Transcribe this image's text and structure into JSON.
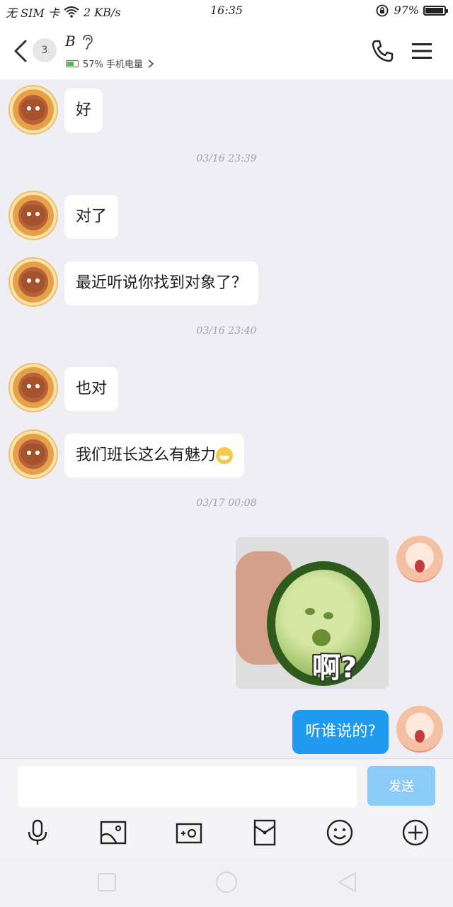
{
  "status_bar": {
    "sim": "无 SIM 卡",
    "speed": "2 KB/s",
    "time": "16:35",
    "battery_percent": "97%",
    "battery_level": 0.97
  },
  "header": {
    "unread_count": "3",
    "contact_name": "B",
    "sub_status": "57% 手机电量",
    "peer_battery_level": 0.57
  },
  "messages": [
    {
      "side": "left",
      "text": "好"
    },
    {
      "type": "timestamp",
      "text": "03/16 23:39"
    },
    {
      "side": "left",
      "text": "对了"
    },
    {
      "side": "left",
      "text": "最近听说你找到对象了？"
    },
    {
      "type": "timestamp",
      "text": "03/16 23:40"
    },
    {
      "side": "left",
      "text": "也对"
    },
    {
      "side": "left",
      "text": "我们班长这么有魅力"
    },
    {
      "type": "timestamp",
      "text": "03/17 00:08"
    },
    {
      "side": "right",
      "type": "sticker",
      "caption": "啊?"
    },
    {
      "side": "right",
      "text": "听谁说的?"
    }
  ],
  "input": {
    "placeholder": "",
    "send_label": "发送"
  },
  "toolbar": {
    "icons": [
      "microphone-icon",
      "image-icon",
      "camera-icon",
      "red-packet-icon",
      "emoji-icon",
      "plus-icon"
    ]
  },
  "colors": {
    "accent": "#1e9bf0",
    "send_disabled": "#8ccaf8",
    "chat_bg": "#eeeef4"
  }
}
